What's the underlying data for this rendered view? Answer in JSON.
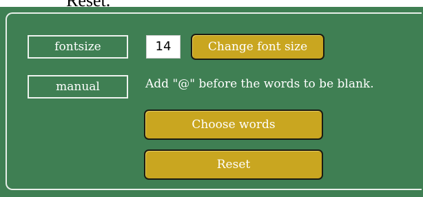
{
  "header": {
    "text": "Reset."
  },
  "fontsize": {
    "label": "fontsize",
    "value": "14",
    "button_label": "Change font size"
  },
  "manual": {
    "label": "manual",
    "hint": "Add \"@\" before the words to be blank."
  },
  "actions": {
    "choose_words_label": "Choose words",
    "reset_label": "Reset"
  }
}
